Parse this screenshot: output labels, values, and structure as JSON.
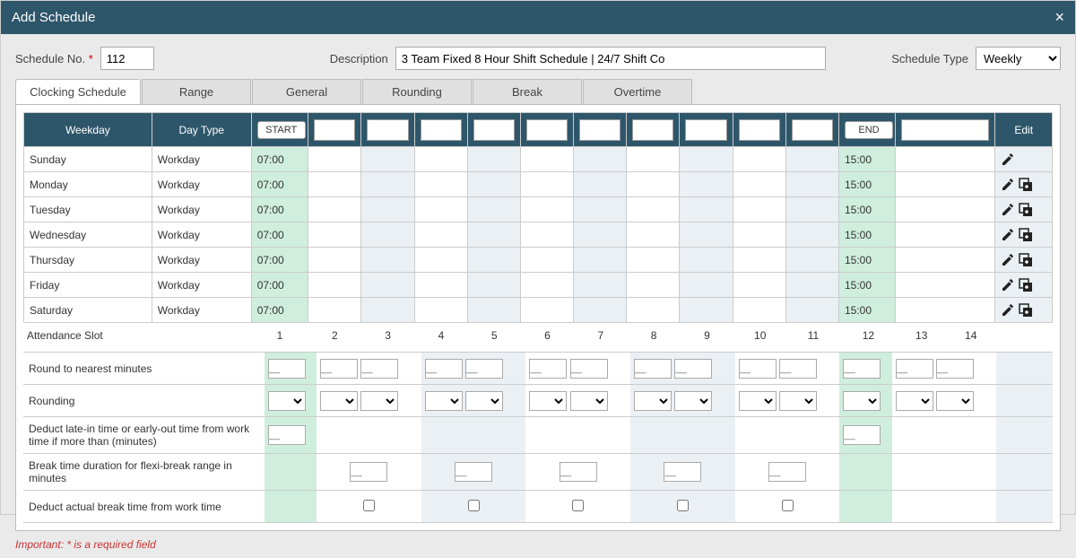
{
  "dialog": {
    "title": "Add Schedule"
  },
  "header": {
    "schedule_no_label": "Schedule No.",
    "schedule_no_value": "112",
    "description_label": "Description",
    "description_value": "3 Team Fixed 8 Hour Shift Schedule | 24/7 Shift Co",
    "schedule_type_label": "Schedule Type",
    "schedule_type_value": "Weekly",
    "schedule_type_options": [
      "Weekly"
    ]
  },
  "tabs": {
    "clocking": "Clocking Schedule",
    "range": "Range",
    "general": "General",
    "rounding": "Rounding",
    "break": "Break",
    "overtime": "Overtime"
  },
  "grid_header": {
    "weekday": "Weekday",
    "daytype": "Day Type",
    "start": "START",
    "end": "END",
    "edit": "Edit"
  },
  "rows": [
    {
      "weekday": "Sunday",
      "daytype": "Workday",
      "start": "07:00",
      "end": "15:00",
      "copy": false
    },
    {
      "weekday": "Monday",
      "daytype": "Workday",
      "start": "07:00",
      "end": "15:00",
      "copy": true
    },
    {
      "weekday": "Tuesday",
      "daytype": "Workday",
      "start": "07:00",
      "end": "15:00",
      "copy": true
    },
    {
      "weekday": "Wednesday",
      "daytype": "Workday",
      "start": "07:00",
      "end": "15:00",
      "copy": true
    },
    {
      "weekday": "Thursday",
      "daytype": "Workday",
      "start": "07:00",
      "end": "15:00",
      "copy": true
    },
    {
      "weekday": "Friday",
      "daytype": "Workday",
      "start": "07:00",
      "end": "15:00",
      "copy": true
    },
    {
      "weekday": "Saturday",
      "daytype": "Workday",
      "start": "07:00",
      "end": "15:00",
      "copy": true
    }
  ],
  "slots": {
    "label": "Attendance Slot",
    "numbers": [
      "1",
      "2",
      "3",
      "4",
      "5",
      "6",
      "7",
      "8",
      "9",
      "10",
      "11",
      "12",
      "13",
      "14"
    ]
  },
  "sub_rows": {
    "round_nearest": "Round to nearest minutes",
    "rounding": "Rounding",
    "deduct_late": "Deduct late-in time or early-out time from work time if more than (minutes)",
    "break_duration": "Break time duration for flexi-break range in minutes",
    "deduct_break": "Deduct actual break time from work time"
  },
  "footer": {
    "note": "Important: * is a required field"
  },
  "icons": {
    "pencil": "pencil-icon",
    "copy_add": "copy-add-icon",
    "close": "close-icon"
  }
}
